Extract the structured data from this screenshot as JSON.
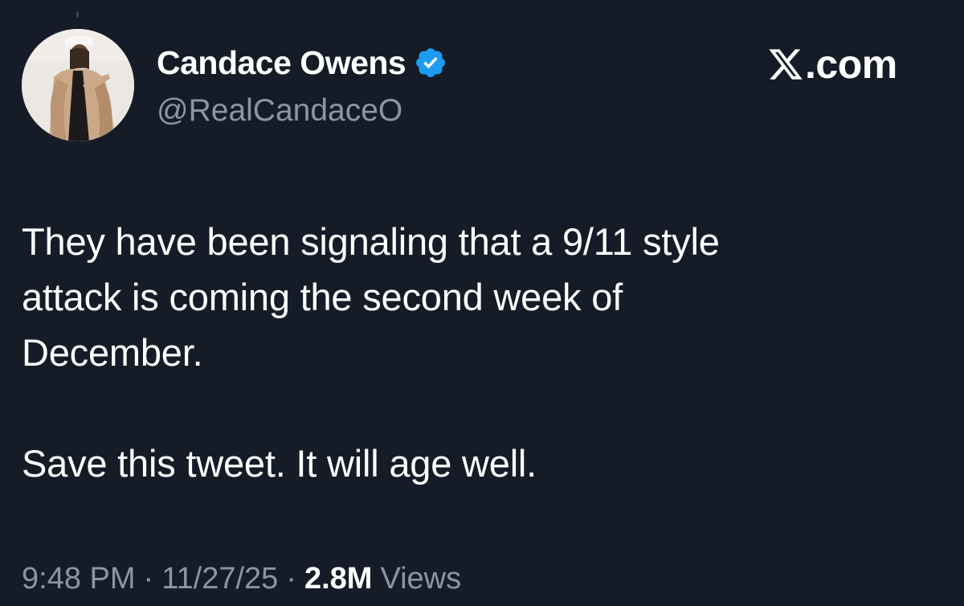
{
  "author": {
    "display_name": "Candace Owens",
    "handle": "@RealCandaceO",
    "verified_icon": "verified-badge-icon",
    "avatar_icon": "profile-photo"
  },
  "brand": {
    "logo_icon": "x-logo-icon",
    "text": ".com"
  },
  "tweet": {
    "paragraph_1": "They have been signaling that a 9/11 style\nattack is coming the second week of\nDecember.",
    "paragraph_2": "Save this tweet. It will age well."
  },
  "meta": {
    "time": "9:48 PM",
    "separator": "·",
    "date": "11/27/25",
    "views_count": "2.8M",
    "views_label": "Views"
  },
  "colors": {
    "background": "#161c27",
    "text_primary": "#ffffff",
    "text_secondary": "#8b96a3",
    "verified_blue": "#1d9bf0"
  }
}
